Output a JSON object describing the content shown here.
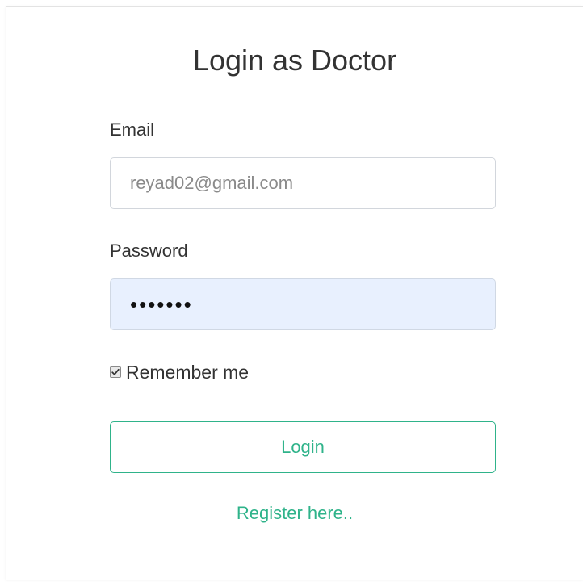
{
  "form": {
    "title": "Login as Doctor",
    "email_label": "Email",
    "email_value": "reyad02@gmail.com",
    "password_label": "Password",
    "password_value": "•••••••",
    "remember_label": "Remember me",
    "remember_checked": true,
    "login_label": "Login",
    "register_label": "Register here.."
  },
  "colors": {
    "accent": "#2fb38a",
    "autofill_bg": "#e8f0fe"
  }
}
